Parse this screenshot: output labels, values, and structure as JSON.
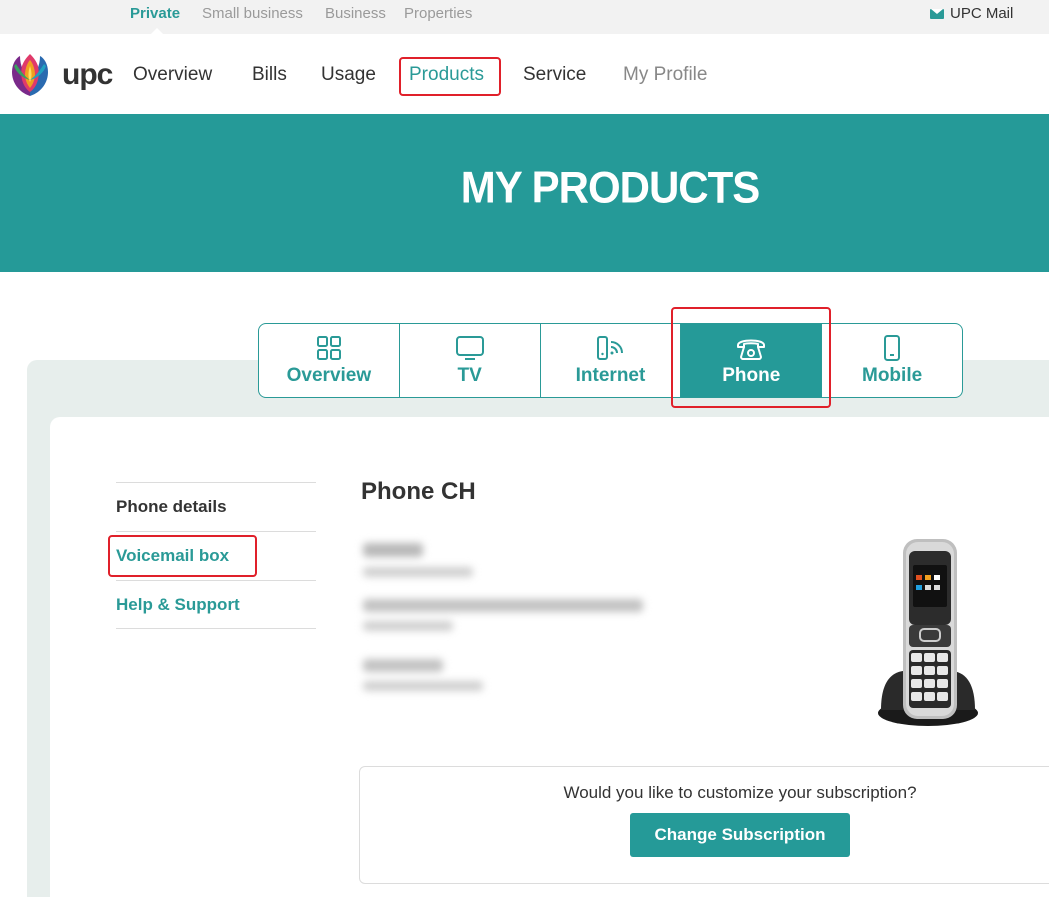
{
  "segments": {
    "items": [
      "Private",
      "Small business",
      "Business",
      "Properties"
    ],
    "active": "Private",
    "mail_label": "UPC Mail"
  },
  "brand": {
    "logo_text": "upc"
  },
  "nav": {
    "items": [
      "Overview",
      "Bills",
      "Usage",
      "Products",
      "Service",
      "My Profile"
    ],
    "active": "Products"
  },
  "banner": {
    "title": "MY PRODUCTS"
  },
  "tabs": {
    "items": [
      {
        "label": "Overview",
        "icon": "grid-icon"
      },
      {
        "label": "TV",
        "icon": "tv-icon"
      },
      {
        "label": "Internet",
        "icon": "router-icon"
      },
      {
        "label": "Phone",
        "icon": "telephone-icon"
      },
      {
        "label": "Mobile",
        "icon": "mobile-phone-icon"
      }
    ],
    "active": "Phone"
  },
  "side_menu": {
    "items": [
      "Phone details",
      "Voicemail box",
      "Help & Support"
    ],
    "active": "Phone details"
  },
  "product": {
    "title": "Phone CH",
    "image": "cordless-phone-image"
  },
  "cta": {
    "question": "Would you like to customize your subscription?",
    "button_label": "Change Subscription"
  },
  "colors": {
    "brand_teal": "#259a98",
    "highlight_red": "#e0202a",
    "panel_bg": "#e7eeec"
  }
}
